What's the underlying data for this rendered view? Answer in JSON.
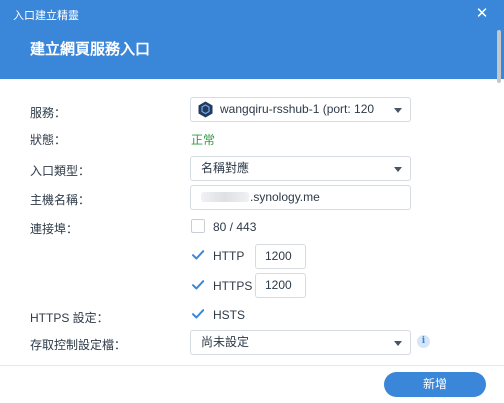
{
  "window": {
    "title": "入口建立精靈",
    "close_icon": "close-icon"
  },
  "heading": "建立網頁服務入口",
  "fields": {
    "service": {
      "label": "服務：",
      "value": "wangqiru-rsshub-1 (port: 120",
      "icon": "container-hexagon-icon"
    },
    "status": {
      "label": "狀態：",
      "value": "正常",
      "color": "#2e9e41"
    },
    "portal_type": {
      "label": "入口類型：",
      "value": "名稱對應"
    },
    "hostname": {
      "label": "主機名稱：",
      "value": ".synology.me"
    },
    "port": {
      "label": "連接埠：",
      "option_80_443": {
        "label": "80 / 443",
        "checked": false
      },
      "http": {
        "label": "HTTP",
        "checked": true,
        "port": "1200"
      },
      "https": {
        "label": "HTTPS",
        "checked": true,
        "port": "1200"
      }
    },
    "https_settings": {
      "label": "HTTPS 設定：",
      "hsts": {
        "label": "HSTS",
        "checked": true
      }
    },
    "access_control": {
      "label": "存取控制設定檔：",
      "value": "尚未設定",
      "info_icon": "i"
    }
  },
  "footer": {
    "create_button": "新增"
  },
  "colors": {
    "accent": "#3a86d9",
    "status_ok": "#2e9e41",
    "text": "#2d3a48"
  }
}
